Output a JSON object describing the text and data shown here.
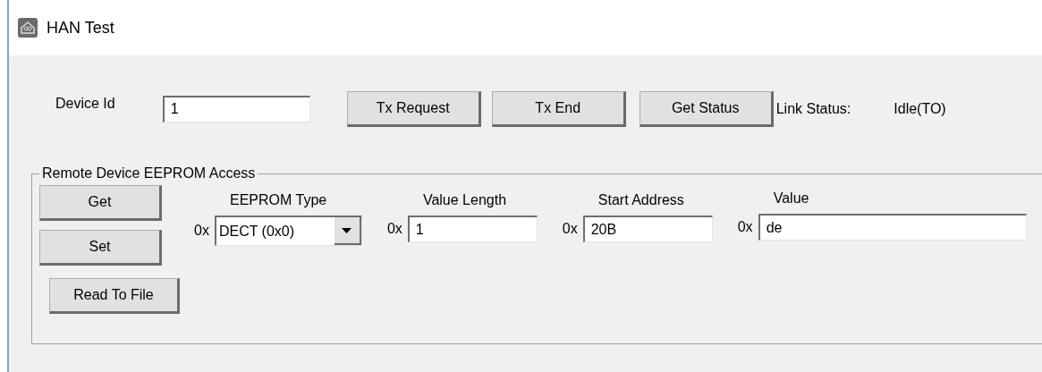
{
  "window": {
    "title": "HAN Test"
  },
  "device_id": {
    "label": "Device Id",
    "value": "1"
  },
  "buttons": [
    "Tx Request",
    "Tx End",
    "Get Status"
  ],
  "link_status": {
    "label": "Link Status:",
    "value": "Idle(TO)"
  },
  "eeprom_group": {
    "legend": "Remote Device EEPROM Access",
    "action_buttons": [
      "Get",
      "Set"
    ],
    "read_button": "Read To File",
    "fields": [
      {
        "kind": "dropdown",
        "label": "EEPROM Type",
        "prefix": "0x",
        "value": "DECT (0x0)"
      },
      {
        "kind": "text",
        "label": "Value Length",
        "prefix": "0x",
        "value": "1"
      },
      {
        "kind": "text",
        "label": "Start Address",
        "prefix": "0x",
        "value": "20B"
      },
      {
        "kind": "text",
        "label": "Value",
        "prefix": "0x",
        "value": "de"
      }
    ]
  }
}
